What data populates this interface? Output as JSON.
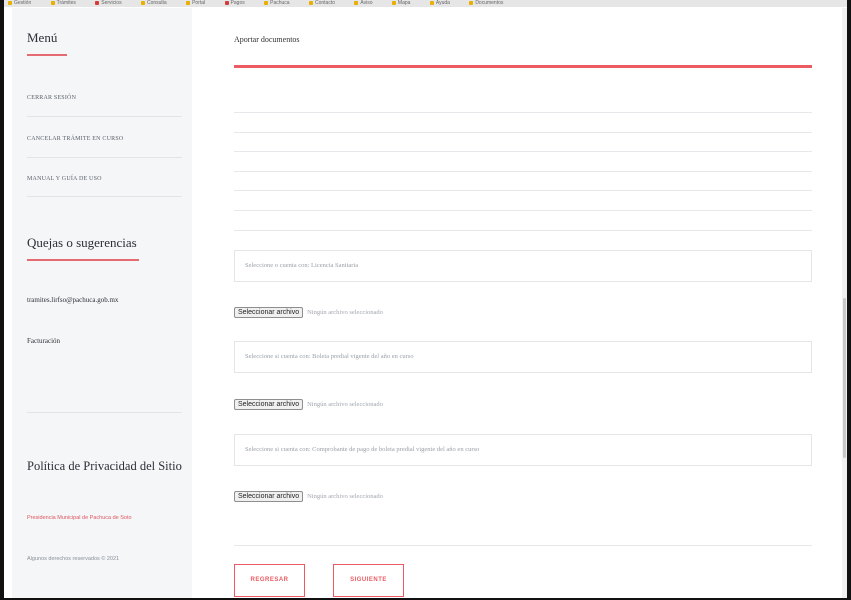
{
  "bookmarks": [
    "Gestión",
    "Trámites",
    "Servicios",
    "Consulta",
    "Portal",
    "Pagos",
    "Pachuca",
    "Contacto",
    "Aviso",
    "Mapa",
    "Ayuda",
    "Documentos"
  ],
  "sidebar": {
    "menu_title": "Menú",
    "menu_items": [
      "CERRAR SESIÓN",
      "CANCELAR TRÁMITE EN CURSO",
      "MANUAL Y GUÍA DE USO"
    ],
    "quejas_title": "Quejas o sugerencias",
    "email": "tramites.lirfso@pachuca.gob.mx",
    "facturacion": "Facturación",
    "privacy_title": "Política de Privacidad del Sitio",
    "privacy_link": "Presidencia Municipal de Pachuca de Soto",
    "rights": "Algunos derechos reservados © 2021"
  },
  "main": {
    "section_title": "Aportar documentos",
    "inputs": [
      {
        "placeholder": "Seleccione o cuenta con: Licencia Sanitaria"
      },
      {
        "placeholder": "Seleccione si cuenta con: Boleta predial vigente del año en curso"
      },
      {
        "placeholder": "Seleccione si cuenta con: Comprobante de pago de boleta predial vigente del año en curso"
      }
    ],
    "file_button": "Seleccionar archivo",
    "file_status": "Ningún archivo seleccionado",
    "btn_back": "REGRESAR",
    "btn_next": "SIGUIENTE"
  },
  "colors": {
    "accent": "#ec5a62",
    "sidebar_bg": "#f4f6f8"
  }
}
